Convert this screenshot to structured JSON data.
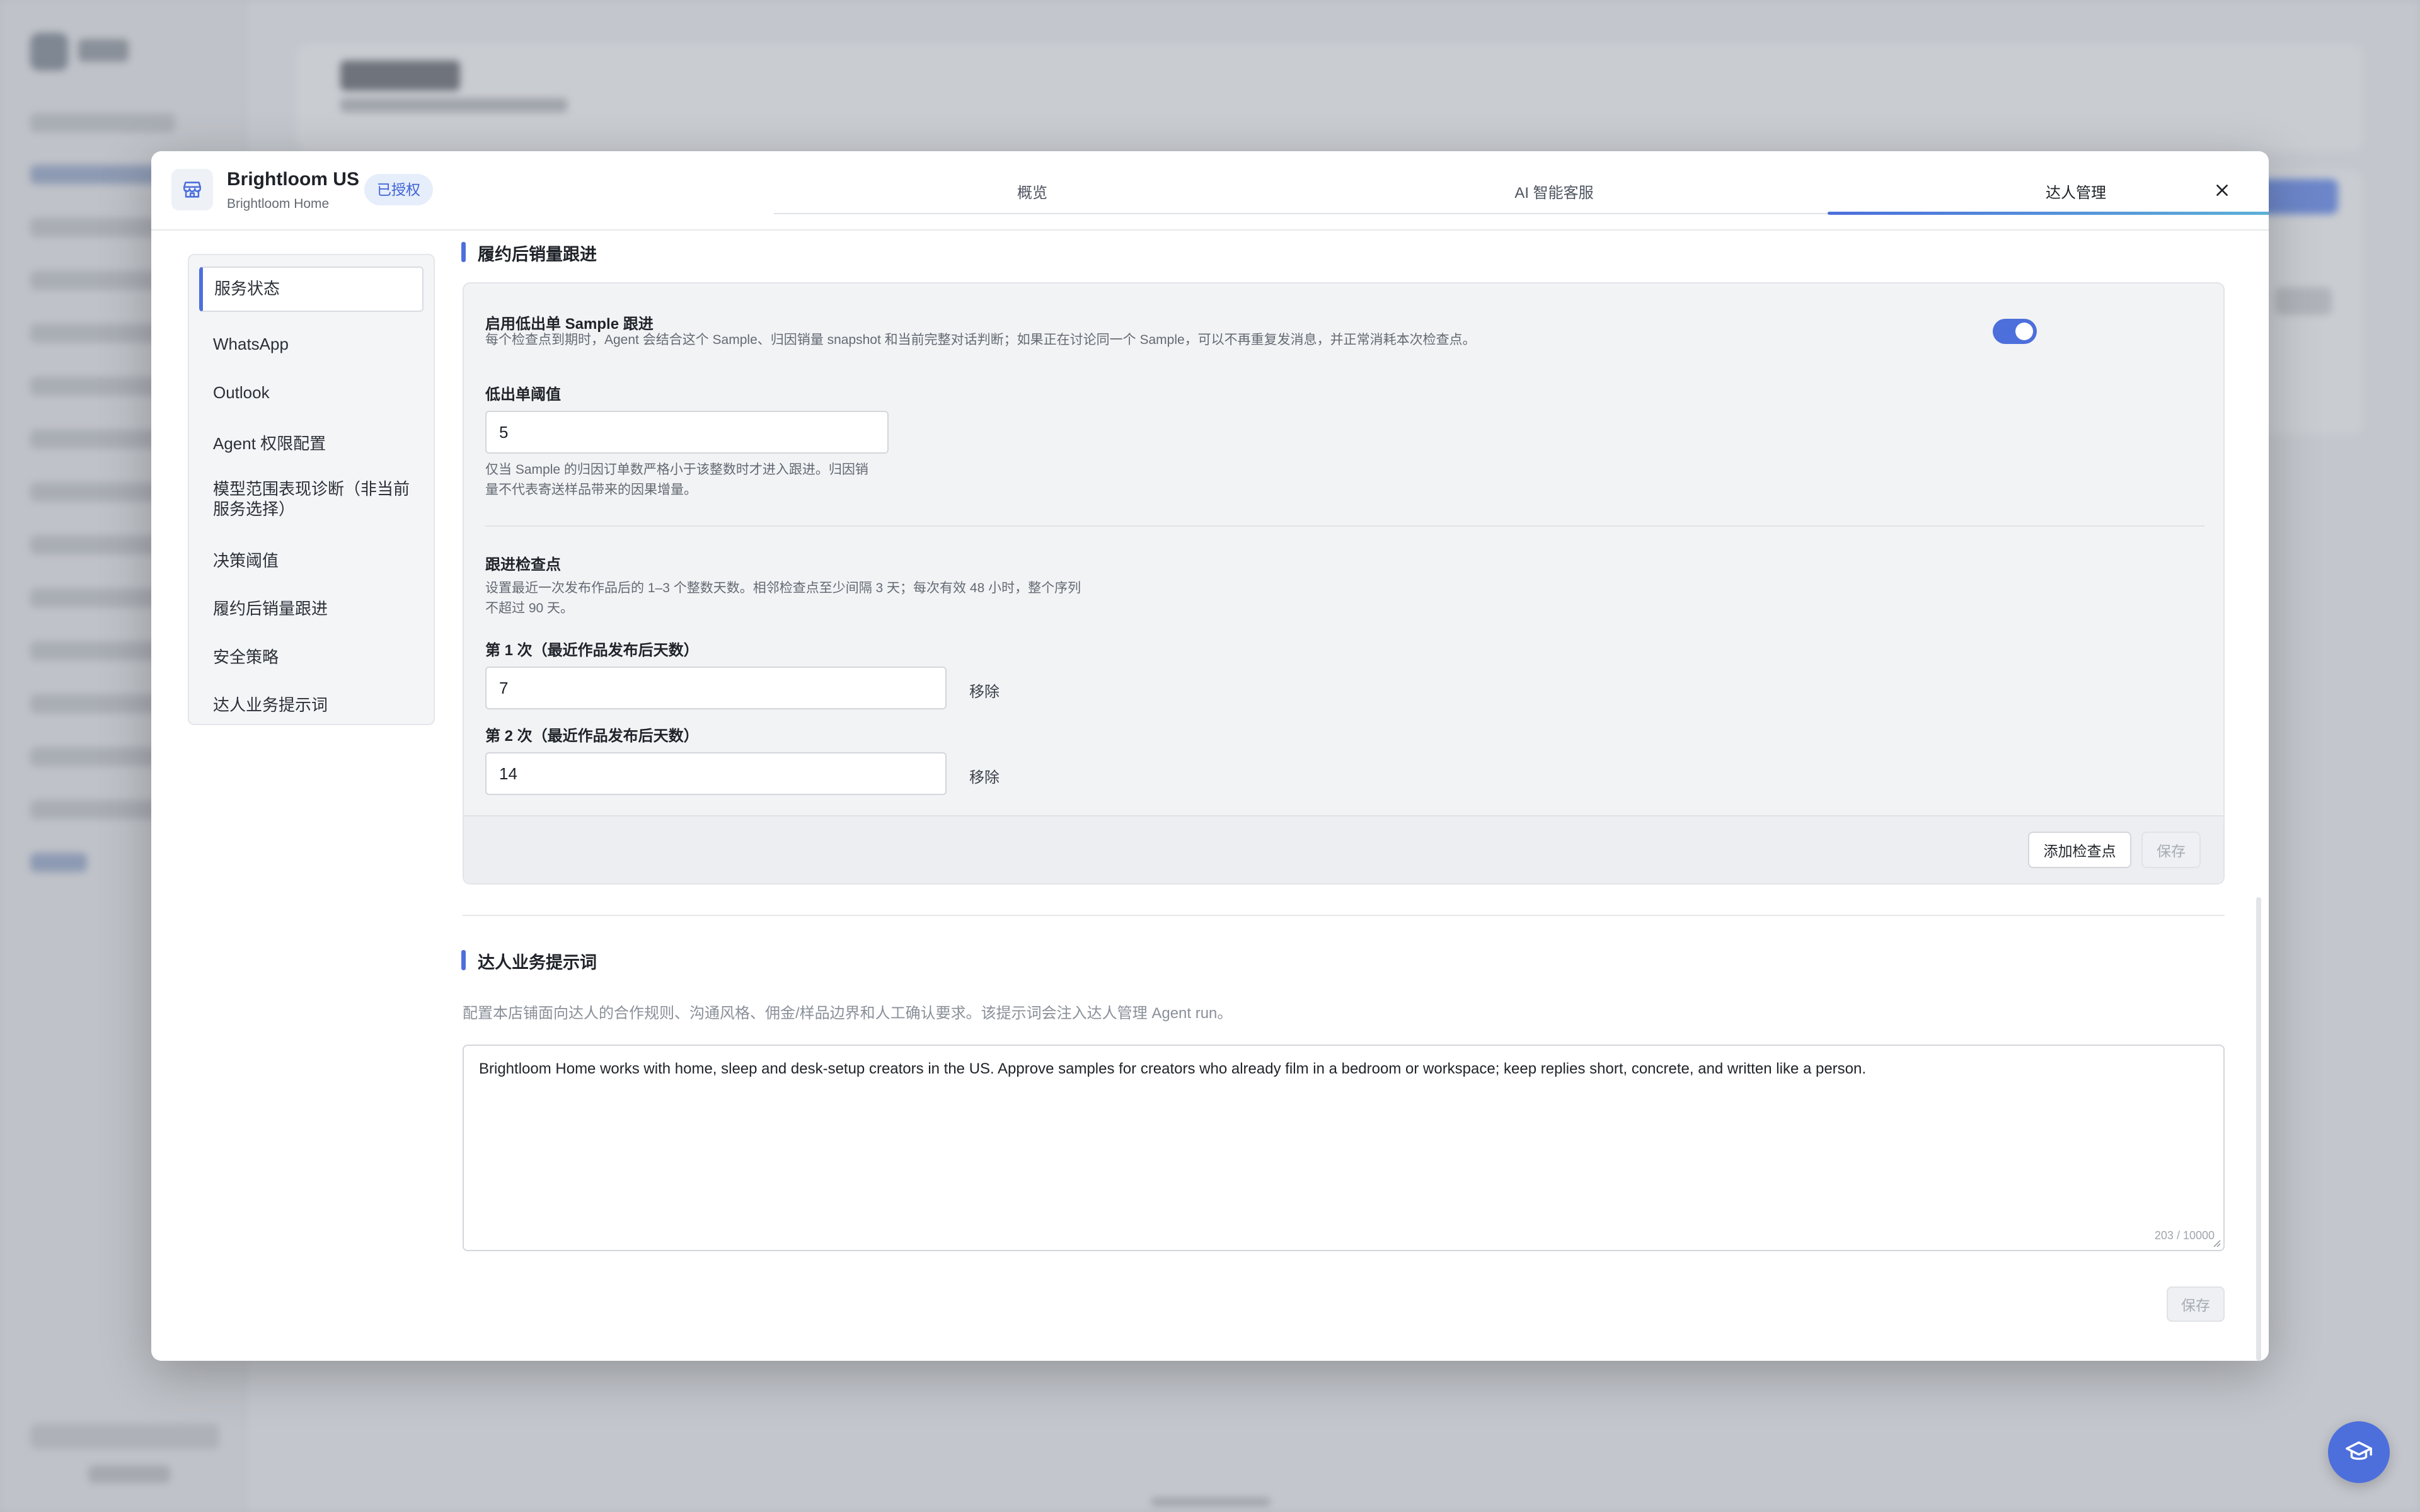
{
  "modal": {
    "store_name": "Brightloom US",
    "store_sub": "Brightloom Home",
    "auth_badge": "已授权",
    "tabs": [
      {
        "label": "概览"
      },
      {
        "label": "AI 智能客服"
      },
      {
        "label": "达人管理"
      }
    ],
    "active_tab": "达人管理",
    "close_icon": "close-icon",
    "store_icon": "store-icon"
  },
  "sidebar": {
    "items": [
      {
        "label": "服务状态"
      },
      {
        "label": "WhatsApp"
      },
      {
        "label": "Outlook"
      },
      {
        "label": "Agent 权限配置"
      },
      {
        "label": "模型范围表现诊断（非当前服务选择）"
      },
      {
        "label": "决策阈值"
      },
      {
        "label": "履约后销量跟进"
      },
      {
        "label": "安全策略"
      },
      {
        "label": "达人业务提示词"
      }
    ],
    "active_item": "服务状态"
  },
  "followup": {
    "section_title": "履约后销量跟进",
    "enable_label": "启用低出单 Sample 跟进",
    "enable_desc": "每个检查点到期时，Agent 会结合这个 Sample、归因销量 snapshot 和当前完整对话判断；如果正在讨论同一个 Sample，可以不再重复发消息，并正常消耗本次检查点。",
    "enabled": true,
    "threshold_label": "低出单阈值",
    "threshold_value": "5",
    "threshold_desc_1": "仅当 Sample 的归因订单数严格小于该整数时才进入跟进。归因销",
    "threshold_desc_2": "量不代表寄送样品带来的因果增量。",
    "checkpoints_title": "跟进检查点",
    "checkpoints_desc_1": "设置最近一次发布作品后的 1–3 个整数天数。相邻检查点至少间隔 3 天；每次有效 48 小时，整个序列",
    "checkpoints_desc_2": "不超过 90 天。",
    "checkpoints": [
      {
        "label": "第 1 次（最近作品发布后天数）",
        "value": "7",
        "remove": "移除"
      },
      {
        "label": "第 2 次（最近作品发布后天数）",
        "value": "14",
        "remove": "移除"
      }
    ],
    "add_button": "添加检查点",
    "save_button": "保存"
  },
  "prompt": {
    "section_title": "达人业务提示词",
    "description": "配置本店铺面向达人的合作规则、沟通风格、佣金/样品边界和人工确认要求。该提示词会注入达人管理 Agent run。",
    "text": "Brightloom Home works with home, sleep and desk-setup creators in the US. Approve samples for creators who already film in a bedroom or workspace; keep replies short, concrete, and written like a person.",
    "char_count": "203 / 10000",
    "save_button": "保存"
  },
  "colors": {
    "accent": "#4d6fdc",
    "badge_bg": "#e6edfb",
    "panel_bg": "#f2f3f5"
  },
  "help_fab_icon": "graduation-cap-icon"
}
